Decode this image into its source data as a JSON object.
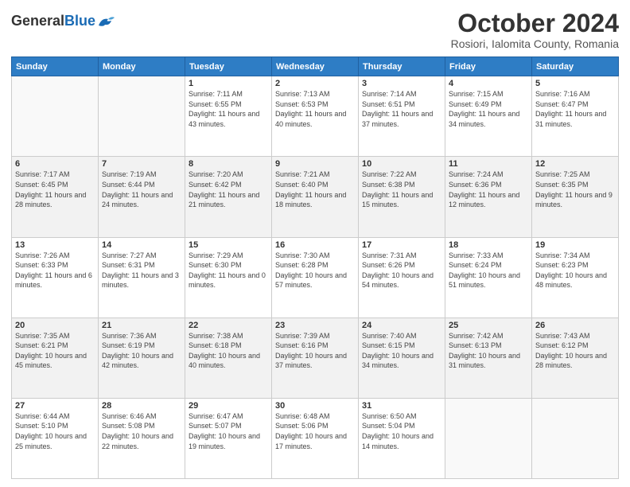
{
  "header": {
    "logo_general": "General",
    "logo_blue": "Blue",
    "month": "October 2024",
    "location": "Rosiori, Ialomita County, Romania"
  },
  "weekdays": [
    "Sunday",
    "Monday",
    "Tuesday",
    "Wednesday",
    "Thursday",
    "Friday",
    "Saturday"
  ],
  "weeks": [
    [
      {
        "day": "",
        "sunrise": "",
        "sunset": "",
        "daylight": ""
      },
      {
        "day": "",
        "sunrise": "",
        "sunset": "",
        "daylight": ""
      },
      {
        "day": "1",
        "sunrise": "Sunrise: 7:11 AM",
        "sunset": "Sunset: 6:55 PM",
        "daylight": "Daylight: 11 hours and 43 minutes."
      },
      {
        "day": "2",
        "sunrise": "Sunrise: 7:13 AM",
        "sunset": "Sunset: 6:53 PM",
        "daylight": "Daylight: 11 hours and 40 minutes."
      },
      {
        "day": "3",
        "sunrise": "Sunrise: 7:14 AM",
        "sunset": "Sunset: 6:51 PM",
        "daylight": "Daylight: 11 hours and 37 minutes."
      },
      {
        "day": "4",
        "sunrise": "Sunrise: 7:15 AM",
        "sunset": "Sunset: 6:49 PM",
        "daylight": "Daylight: 11 hours and 34 minutes."
      },
      {
        "day": "5",
        "sunrise": "Sunrise: 7:16 AM",
        "sunset": "Sunset: 6:47 PM",
        "daylight": "Daylight: 11 hours and 31 minutes."
      }
    ],
    [
      {
        "day": "6",
        "sunrise": "Sunrise: 7:17 AM",
        "sunset": "Sunset: 6:45 PM",
        "daylight": "Daylight: 11 hours and 28 minutes."
      },
      {
        "day": "7",
        "sunrise": "Sunrise: 7:19 AM",
        "sunset": "Sunset: 6:44 PM",
        "daylight": "Daylight: 11 hours and 24 minutes."
      },
      {
        "day": "8",
        "sunrise": "Sunrise: 7:20 AM",
        "sunset": "Sunset: 6:42 PM",
        "daylight": "Daylight: 11 hours and 21 minutes."
      },
      {
        "day": "9",
        "sunrise": "Sunrise: 7:21 AM",
        "sunset": "Sunset: 6:40 PM",
        "daylight": "Daylight: 11 hours and 18 minutes."
      },
      {
        "day": "10",
        "sunrise": "Sunrise: 7:22 AM",
        "sunset": "Sunset: 6:38 PM",
        "daylight": "Daylight: 11 hours and 15 minutes."
      },
      {
        "day": "11",
        "sunrise": "Sunrise: 7:24 AM",
        "sunset": "Sunset: 6:36 PM",
        "daylight": "Daylight: 11 hours and 12 minutes."
      },
      {
        "day": "12",
        "sunrise": "Sunrise: 7:25 AM",
        "sunset": "Sunset: 6:35 PM",
        "daylight": "Daylight: 11 hours and 9 minutes."
      }
    ],
    [
      {
        "day": "13",
        "sunrise": "Sunrise: 7:26 AM",
        "sunset": "Sunset: 6:33 PM",
        "daylight": "Daylight: 11 hours and 6 minutes."
      },
      {
        "day": "14",
        "sunrise": "Sunrise: 7:27 AM",
        "sunset": "Sunset: 6:31 PM",
        "daylight": "Daylight: 11 hours and 3 minutes."
      },
      {
        "day": "15",
        "sunrise": "Sunrise: 7:29 AM",
        "sunset": "Sunset: 6:30 PM",
        "daylight": "Daylight: 11 hours and 0 minutes."
      },
      {
        "day": "16",
        "sunrise": "Sunrise: 7:30 AM",
        "sunset": "Sunset: 6:28 PM",
        "daylight": "Daylight: 10 hours and 57 minutes."
      },
      {
        "day": "17",
        "sunrise": "Sunrise: 7:31 AM",
        "sunset": "Sunset: 6:26 PM",
        "daylight": "Daylight: 10 hours and 54 minutes."
      },
      {
        "day": "18",
        "sunrise": "Sunrise: 7:33 AM",
        "sunset": "Sunset: 6:24 PM",
        "daylight": "Daylight: 10 hours and 51 minutes."
      },
      {
        "day": "19",
        "sunrise": "Sunrise: 7:34 AM",
        "sunset": "Sunset: 6:23 PM",
        "daylight": "Daylight: 10 hours and 48 minutes."
      }
    ],
    [
      {
        "day": "20",
        "sunrise": "Sunrise: 7:35 AM",
        "sunset": "Sunset: 6:21 PM",
        "daylight": "Daylight: 10 hours and 45 minutes."
      },
      {
        "day": "21",
        "sunrise": "Sunrise: 7:36 AM",
        "sunset": "Sunset: 6:19 PM",
        "daylight": "Daylight: 10 hours and 42 minutes."
      },
      {
        "day": "22",
        "sunrise": "Sunrise: 7:38 AM",
        "sunset": "Sunset: 6:18 PM",
        "daylight": "Daylight: 10 hours and 40 minutes."
      },
      {
        "day": "23",
        "sunrise": "Sunrise: 7:39 AM",
        "sunset": "Sunset: 6:16 PM",
        "daylight": "Daylight: 10 hours and 37 minutes."
      },
      {
        "day": "24",
        "sunrise": "Sunrise: 7:40 AM",
        "sunset": "Sunset: 6:15 PM",
        "daylight": "Daylight: 10 hours and 34 minutes."
      },
      {
        "day": "25",
        "sunrise": "Sunrise: 7:42 AM",
        "sunset": "Sunset: 6:13 PM",
        "daylight": "Daylight: 10 hours and 31 minutes."
      },
      {
        "day": "26",
        "sunrise": "Sunrise: 7:43 AM",
        "sunset": "Sunset: 6:12 PM",
        "daylight": "Daylight: 10 hours and 28 minutes."
      }
    ],
    [
      {
        "day": "27",
        "sunrise": "Sunrise: 6:44 AM",
        "sunset": "Sunset: 5:10 PM",
        "daylight": "Daylight: 10 hours and 25 minutes."
      },
      {
        "day": "28",
        "sunrise": "Sunrise: 6:46 AM",
        "sunset": "Sunset: 5:08 PM",
        "daylight": "Daylight: 10 hours and 22 minutes."
      },
      {
        "day": "29",
        "sunrise": "Sunrise: 6:47 AM",
        "sunset": "Sunset: 5:07 PM",
        "daylight": "Daylight: 10 hours and 19 minutes."
      },
      {
        "day": "30",
        "sunrise": "Sunrise: 6:48 AM",
        "sunset": "Sunset: 5:06 PM",
        "daylight": "Daylight: 10 hours and 17 minutes."
      },
      {
        "day": "31",
        "sunrise": "Sunrise: 6:50 AM",
        "sunset": "Sunset: 5:04 PM",
        "daylight": "Daylight: 10 hours and 14 minutes."
      },
      {
        "day": "",
        "sunrise": "",
        "sunset": "",
        "daylight": ""
      },
      {
        "day": "",
        "sunrise": "",
        "sunset": "",
        "daylight": ""
      }
    ]
  ]
}
